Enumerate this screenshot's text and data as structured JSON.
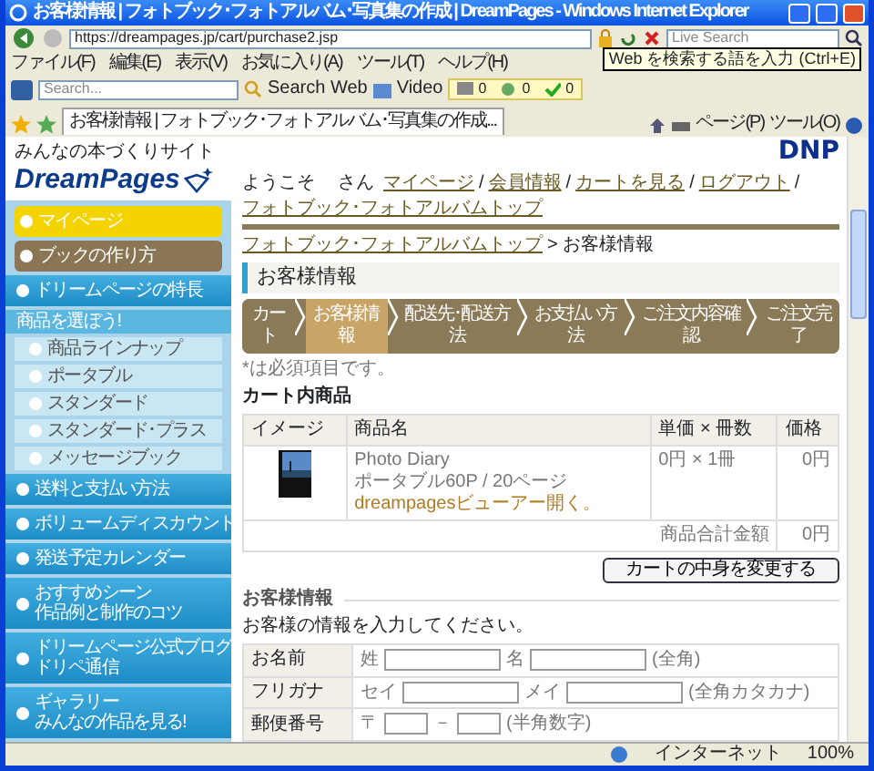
{
  "window": {
    "title": "お客様情報 | フォトブック･フォトアルバム･写真集の作成 | DreamPages - Windows Internet Explorer"
  },
  "address_bar": {
    "url": "https://dreampages.jp/cart/purchase2.jsp",
    "search_placeholder": "Live Search",
    "tooltip": "Web を検索する語を入力 (Ctrl+E)"
  },
  "menu": [
    "ファイル(F)",
    "編集(E)",
    "表示(V)",
    "お気に入り(A)",
    "ツール(T)",
    "ヘルプ(H)"
  ],
  "toolbar": {
    "search_placeholder": "Search...",
    "search_button": "Search Web",
    "video": "Video",
    "counters": [
      "0",
      "0",
      "0"
    ]
  },
  "tab": {
    "title": "お客様情報 | フォトブック･フォトアルバム･写真集の作成..."
  },
  "command_bar": [
    "ページ(P)",
    "ツール(O)"
  ],
  "site": {
    "tagline": "みんなの本づくりサイト",
    "logo": "DreamPages",
    "brand": "DNP",
    "welcome": "ようこそ",
    "san": "さん",
    "separator": "/",
    "links": [
      "マイページ",
      "会員情報",
      "カートを見る",
      "ログアウト",
      "フォトブック･フォトアルバムトップ"
    ]
  },
  "sidebar": {
    "items": [
      {
        "kind": "yellow",
        "label": "マイページ"
      },
      {
        "kind": "brown",
        "label": "ブックの作り方"
      },
      {
        "kind": "main",
        "label": "ドリームページの特長"
      },
      {
        "kind": "header",
        "label": "商品を選ぼう!"
      },
      {
        "kind": "sub",
        "label": "商品ラインナップ"
      },
      {
        "kind": "sub",
        "label": "ポータブル"
      },
      {
        "kind": "sub",
        "label": "スタンダード"
      },
      {
        "kind": "sub",
        "label": "スタンダード･プラス"
      },
      {
        "kind": "sub",
        "label": "メッセージブック"
      },
      {
        "kind": "main",
        "label": "送料と支払い方法"
      },
      {
        "kind": "main",
        "label": "ボリュームディスカウント"
      },
      {
        "kind": "main",
        "label": "発送予定カレンダー"
      },
      {
        "kind": "main",
        "label": "おすすめシーン",
        "caption": "作品例と制作のコツ"
      },
      {
        "kind": "main",
        "label": "ドリペ通信",
        "kicker": "ドリームページ公式ブログ"
      },
      {
        "kind": "main",
        "label": "ギャラリー",
        "caption": "みんなの作品を見る!"
      }
    ]
  },
  "breadcrumb": {
    "separator": ">",
    "items": [
      "フォトブック･フォトアルバムトップ",
      "お客様情報"
    ]
  },
  "page_title": "お客様情報",
  "steps": [
    {
      "label": "カート",
      "selected": false
    },
    {
      "label": "お客様情報",
      "selected": true
    },
    {
      "label": "配送先･配送方法",
      "selected": false
    },
    {
      "label": "お支払い方法",
      "selected": false
    },
    {
      "label": "ご注文内容確認",
      "selected": false
    },
    {
      "label": "ご注文完了",
      "selected": false
    }
  ],
  "note": "*は必須項目です。",
  "cart": {
    "title": "カート内商品",
    "columns": [
      "イメージ",
      "商品名",
      "単価 × 冊数",
      "価格"
    ],
    "rows": [
      {
        "name": "Photo Diary",
        "spec": "ポータブル60P / 20ページ",
        "viewer_link": "dreampagesビューアー開く。",
        "unit": "0円 × 1冊",
        "price": "0円"
      }
    ],
    "total_label": "商品合計金額",
    "total": "0円",
    "change_button": "カートの中身を変更する"
  },
  "customer": {
    "title": "お客様情報",
    "intro": "お客様の情報を入力してください。",
    "fields": [
      {
        "kind": "text",
        "label": "お名前",
        "inputs": [
          {
            "prefix": "姓"
          },
          {
            "prefix": "名"
          }
        ],
        "note": "(全角)"
      },
      {
        "kind": "text",
        "label": "フリガナ",
        "inputs": [
          {
            "prefix": "セイ"
          },
          {
            "prefix": "メイ"
          }
        ],
        "note": "(全角カタカナ)"
      },
      {
        "kind": "postal",
        "label": "郵便番号",
        "inputs": [
          {
            "prefix": "〒"
          },
          {
            "prefix": "－"
          }
        ],
        "note": "(半角数字)"
      }
    ]
  },
  "status_bar": {
    "zone": "インターネット",
    "zoom": "100%"
  }
}
